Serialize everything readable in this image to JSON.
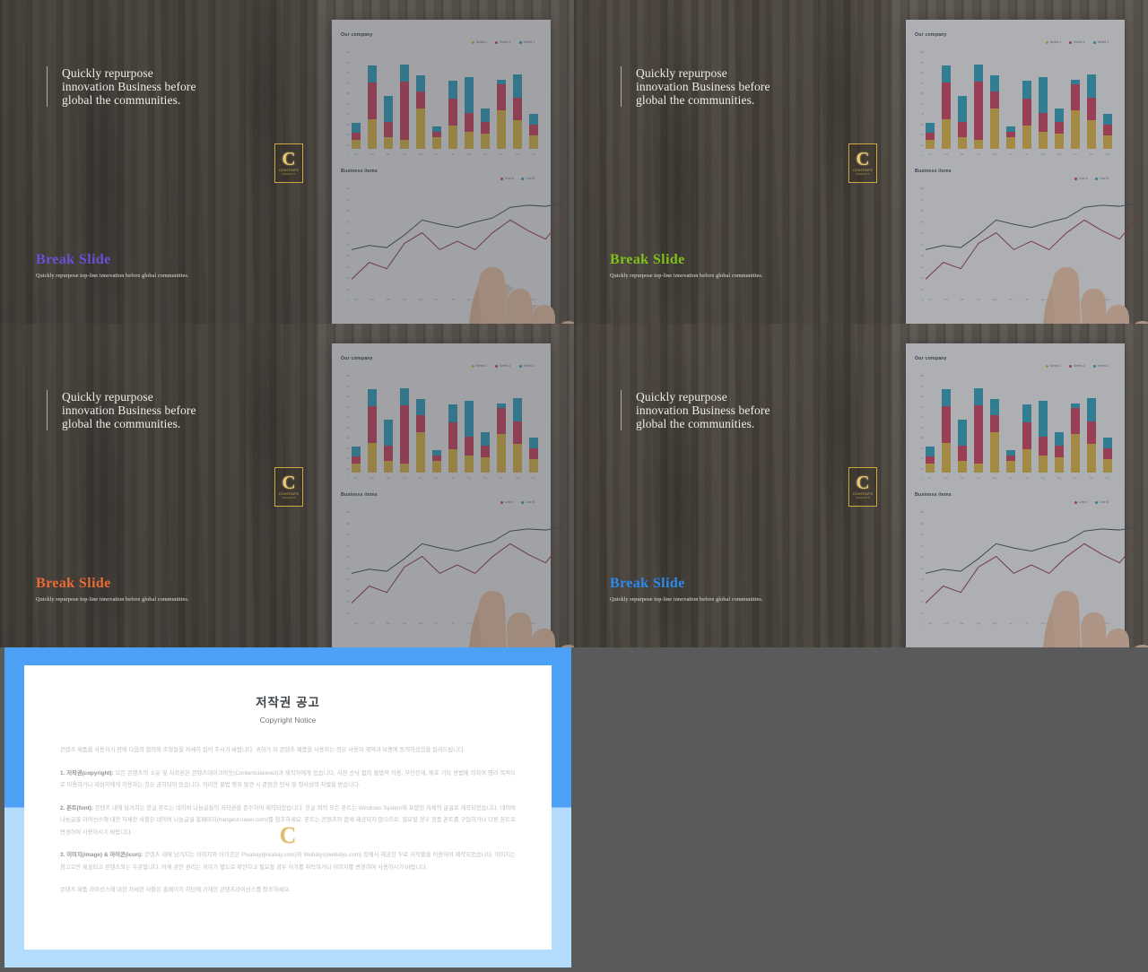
{
  "slides": [
    {
      "quote": "Quickly repurpose innovation Business before global the communities.",
      "title": "Break Slide",
      "title_color": "#6a4fd8",
      "subtitle": "Quickly repurpose top-line innovation before global communities.",
      "logo_letter": "C",
      "logo_word": "CONTENTS",
      "logo_word2": "TAKEOUT"
    },
    {
      "quote": "Quickly repurpose innovation Business before global the communities.",
      "title": "Break Slide",
      "title_color": "#7ec21a",
      "subtitle": "Quickly repurpose top-line innovation before global communities.",
      "logo_letter": "C",
      "logo_word": "CONTENTS",
      "logo_word2": "TAKEOUT"
    },
    {
      "quote": "Quickly repurpose innovation Business before global the communities.",
      "title": "Break Slide",
      "title_color": "#ec6a33",
      "subtitle": "Quickly repurpose top-line innovation before global communities.",
      "logo_letter": "C",
      "logo_word": "CONTENTS",
      "logo_word2": "TAKEOUT"
    },
    {
      "quote": "Quickly repurpose innovation Business before global the communities.",
      "title": "Break Slide",
      "title_color": "#2b8cf0",
      "subtitle": "Quickly repurpose top-line innovation before global communities.",
      "logo_letter": "C",
      "logo_word": "CONTENTS",
      "logo_word2": "TAKEOUT"
    }
  ],
  "chart_data": [
    {
      "type": "bar",
      "title": "Our company",
      "xlabel": "",
      "ylabel": "",
      "ylim": [
        0,
        100
      ],
      "grid": false,
      "legend_position": "top-right",
      "categories": [
        "Jan",
        "Feb",
        "Mar",
        "Apr",
        "May",
        "Jun",
        "Jul",
        "Aug",
        "Sep",
        "Oct",
        "Nov",
        "Dec"
      ],
      "yticks": [
        "100",
        "90",
        "80",
        "70",
        "60",
        "50",
        "40",
        "30",
        "20",
        "10",
        "0"
      ],
      "series": [
        {
          "name": "Series 1",
          "color": "#d9b447",
          "values": [
            9,
            31,
            12,
            9,
            42,
            12,
            24,
            18,
            16,
            40,
            30,
            14
          ]
        },
        {
          "name": "Series 2",
          "color": "#c9405e",
          "values": [
            8,
            38,
            16,
            60,
            17,
            6,
            28,
            19,
            12,
            27,
            23,
            11
          ]
        },
        {
          "name": "Series 3",
          "color": "#2f9ebb",
          "values": [
            10,
            17,
            27,
            18,
            17,
            5,
            18,
            37,
            14,
            4,
            24,
            11
          ]
        }
      ]
    },
    {
      "type": "line",
      "title": "Business items",
      "xlabel": "",
      "ylabel": "",
      "ylim": [
        0,
        100
      ],
      "grid": false,
      "legend_position": "top-right",
      "categories": [
        "Jan",
        "Feb",
        "Mar",
        "Apr",
        "May",
        "Jun",
        "Jul",
        "Aug",
        "Sep",
        "Oct",
        "Nov",
        "Dec"
      ],
      "yticks": [
        "100",
        "90",
        "80",
        "70",
        "60",
        "50",
        "40",
        "30",
        "20",
        "10",
        "0"
      ],
      "series": [
        {
          "name": "Line A",
          "color": "#4b4f58",
          "values": [
            42,
            46,
            44,
            56,
            70,
            66,
            63,
            68,
            72,
            82,
            84,
            83,
            86
          ]
        },
        {
          "name": "Line B",
          "color": "#8e3a4a",
          "values": [
            14,
            30,
            24,
            48,
            58,
            42,
            50,
            42,
            58,
            70,
            60,
            52,
            72
          ]
        }
      ]
    }
  ],
  "chart_legend_bar": [
    {
      "label": "Series 1",
      "color": "#d9b447"
    },
    {
      "label": "Series 2",
      "color": "#c9405e"
    },
    {
      "label": "Series 3",
      "color": "#2f9ebb"
    }
  ],
  "chart_legend_line": [
    {
      "label": "Line A",
      "color": "#c9405e"
    },
    {
      "label": "Line B",
      "color": "#2f9ebb"
    }
  ],
  "copyright": {
    "title": "저작권 공고",
    "subtitle": "Copyright Notice",
    "intro": "콘텐츠 제품을 사용하기 전에 다음의 합의와 조항들을 자세히 읽어 주시기 바랍니다. 귀하가 이 콘텐츠 제품을 사용하는 것은 사용자 계약과 보증에 동의하셨음을 일러드립니다.",
    "item1_label": "1. 저작권(copyright):",
    "item1_text": " 모든 콘텐츠의 소유 및 저작권은 콘텐츠테이크아웃(Contentstakeout)과 제작자에게 있습니다. 사전 승낙 없이 불법적 이용, 무단전재, 배포 기타 방법에 의하여 영리 목적으로 이용하거나 제삼자에게 이용하는 것은 금지되어 있습니다. 이러한 불법 행위 발견 시 준엄한 민사 및 형사상의 처벌을 받습니다.",
    "item2_label": "2. 폰트(font):",
    "item2_text": " 콘텐츠 내에 담겨지는 한글 폰트는 네이버 나눔글꼴의 저작권을 준수하여 제작되었습니다. 한글 외의 모든 폰트는 Windows System에 포함된 자체의 글꼴로 제작되었습니다. 네이버 나눔글꼴 라이선스에 대한 자세한 사항은 네이버 나눔글꼴 홈페이지(hangeul.naver.com)를 참조하세요. 폰트는 콘텐츠와 함께 제공되지 않으므로, 필요할 경우 정품 폰트를 구입하거나 다른 폰트로 변경하여 사용하시기 바랍니다.",
    "item3_label": "3. 이미지(image) & 아이콘(icon):",
    "item3_text": " 콘텐츠 내에 담겨지는 이미지와 아이콘은 Pixabay(pixabay.com)와 Webalys(webalys.com) 등에서 제공한 무료 저작물을 이용하여 제작되었습니다. 이미지는 참고로만 제공되고 콘텐츠와는 무관합니다. 이에 관한 권리는 귀하가 별도로 확인하고 필요할 경우 허가를 취득하거나 이미지를 변경하여 사용하시기 바랍니다.",
    "footer": "콘텐츠 제품 라이선스에 대한 자세한 사항은 홈페이지 하단에 기재한 콘텐츠라이선스를 참조하세요.",
    "watermark_letter": "C",
    "border_color_top": "#4ca0f5",
    "border_color_bottom": "#b3dcfc"
  }
}
